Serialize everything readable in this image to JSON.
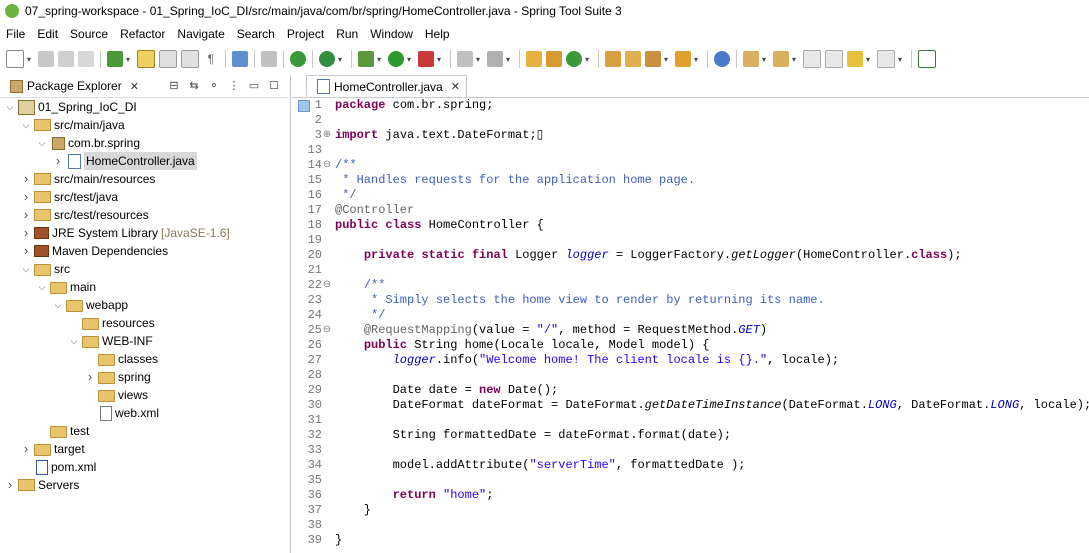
{
  "window": {
    "title": "07_spring-workspace - 01_Spring_IoC_DI/src/main/java/com/br/spring/HomeController.java - Spring Tool Suite 3"
  },
  "menu": [
    "File",
    "Edit",
    "Source",
    "Refactor",
    "Navigate",
    "Search",
    "Project",
    "Run",
    "Window",
    "Help"
  ],
  "package_explorer": {
    "tab_label": "Package Explorer",
    "tree": [
      {
        "label": "01_Spring_IoC_DI",
        "indent": 0,
        "chev": "v",
        "icon": "project"
      },
      {
        "label": "src/main/java",
        "indent": 1,
        "chev": "v",
        "icon": "src"
      },
      {
        "label": "com.br.spring",
        "indent": 2,
        "chev": "v",
        "icon": "pkg"
      },
      {
        "label": "HomeController.java",
        "indent": 3,
        "chev": ">",
        "icon": "java",
        "selected": true
      },
      {
        "label": "src/main/resources",
        "indent": 1,
        "chev": ">",
        "icon": "src"
      },
      {
        "label": "src/test/java",
        "indent": 1,
        "chev": ">",
        "icon": "src"
      },
      {
        "label": "src/test/resources",
        "indent": 1,
        "chev": ">",
        "icon": "src"
      },
      {
        "label": "JRE System Library",
        "deco": "[JavaSE-1.6]",
        "indent": 1,
        "chev": ">",
        "icon": "jar"
      },
      {
        "label": "Maven Dependencies",
        "indent": 1,
        "chev": ">",
        "icon": "jar"
      },
      {
        "label": "src",
        "indent": 1,
        "chev": "v",
        "icon": "folder"
      },
      {
        "label": "main",
        "indent": 2,
        "chev": "v",
        "icon": "folder"
      },
      {
        "label": "webapp",
        "indent": 3,
        "chev": "v",
        "icon": "folder"
      },
      {
        "label": "resources",
        "indent": 4,
        "chev": "",
        "icon": "folder"
      },
      {
        "label": "WEB-INF",
        "indent": 4,
        "chev": "v",
        "icon": "folder"
      },
      {
        "label": "classes",
        "indent": 5,
        "chev": "",
        "icon": "folder"
      },
      {
        "label": "spring",
        "indent": 5,
        "chev": ">",
        "icon": "folder"
      },
      {
        "label": "views",
        "indent": 5,
        "chev": "",
        "icon": "folder"
      },
      {
        "label": "web.xml",
        "indent": 5,
        "chev": "",
        "icon": "xml"
      },
      {
        "label": "test",
        "indent": 2,
        "chev": "",
        "icon": "folder"
      },
      {
        "label": "target",
        "indent": 1,
        "chev": ">",
        "icon": "folder"
      },
      {
        "label": "pom.xml",
        "indent": 1,
        "chev": "",
        "icon": "pom"
      },
      {
        "label": "Servers",
        "indent": 0,
        "chev": ">",
        "icon": "servers"
      }
    ]
  },
  "editor": {
    "tab_label": "HomeController.java",
    "lines": [
      {
        "n": "1",
        "html": "<span class=\"kw\">package</span> com.br.spring;"
      },
      {
        "n": "2",
        "html": ""
      },
      {
        "n": "3",
        "fold": "⊕",
        "html": "<span class=\"kw\">import</span> java.text.DateFormat;▯"
      },
      {
        "n": "13",
        "html": ""
      },
      {
        "n": "14",
        "fold": "⊖",
        "html": "<span class=\"cm\">/**</span>"
      },
      {
        "n": "15",
        "html": "<span class=\"cm\"> * Handles requests for the application home page.</span>"
      },
      {
        "n": "16",
        "html": "<span class=\"cm\"> */</span>"
      },
      {
        "n": "17",
        "html": "<span class=\"an\">@Controller</span>"
      },
      {
        "n": "18",
        "html": "<span class=\"kw\">public</span> <span class=\"kw\">class</span> HomeController {"
      },
      {
        "n": "19",
        "html": ""
      },
      {
        "n": "20",
        "html": "    <span class=\"kw\">private</span> <span class=\"kw\">static</span> <span class=\"kw\">final</span> Logger <span class=\"fld\">logger</span> = LoggerFactory.<span class=\"st\">getLogger</span>(HomeController.<span class=\"kw\">class</span>);"
      },
      {
        "n": "21",
        "html": ""
      },
      {
        "n": "22",
        "fold": "⊖",
        "html": "    <span class=\"cm\">/**</span>"
      },
      {
        "n": "23",
        "html": "<span class=\"cm\">     * Simply selects the home view to render by returning its name.</span>"
      },
      {
        "n": "24",
        "html": "<span class=\"cm\">     */</span>"
      },
      {
        "n": "25",
        "fold": "⊖",
        "html": "    <span class=\"an\">@RequestMapping</span>(value = <span class=\"str\">\"/\"</span>, method = RequestMethod.<span class=\"fld\">GET</span>)"
      },
      {
        "n": "26",
        "html": "    <span class=\"kw\">public</span> String home(Locale locale, Model model) {"
      },
      {
        "n": "27",
        "html": "        <span class=\"fld\">logger</span>.info(<span class=\"str\">\"Welcome home! The client locale is {}.\"</span>, locale);"
      },
      {
        "n": "28",
        "html": ""
      },
      {
        "n": "29",
        "html": "        Date date = <span class=\"kw\">new</span> Date();"
      },
      {
        "n": "30",
        "html": "        DateFormat dateFormat = DateFormat.<span class=\"st\">getDateTimeInstance</span>(DateFormat.<span class=\"fld\">LONG</span>, DateFormat.<span class=\"fld\">LONG</span>, locale);"
      },
      {
        "n": "31",
        "html": ""
      },
      {
        "n": "32",
        "html": "        String formattedDate = dateFormat.format(date);"
      },
      {
        "n": "33",
        "html": ""
      },
      {
        "n": "34",
        "html": "        model.addAttribute(<span class=\"str\">\"serverTime\"</span>, formattedDate );"
      },
      {
        "n": "35",
        "html": ""
      },
      {
        "n": "36",
        "html": "        <span class=\"kw\">return</span> <span class=\"str\">\"home\"</span>;"
      },
      {
        "n": "37",
        "html": "    }"
      },
      {
        "n": "38",
        "html": ""
      },
      {
        "n": "39",
        "html": "}"
      }
    ]
  },
  "colors": {
    "keyword": "#7f0055",
    "comment": "#3f5fbf",
    "string": "#2a00ff",
    "annotation": "#646464",
    "field": "#0000c0"
  }
}
